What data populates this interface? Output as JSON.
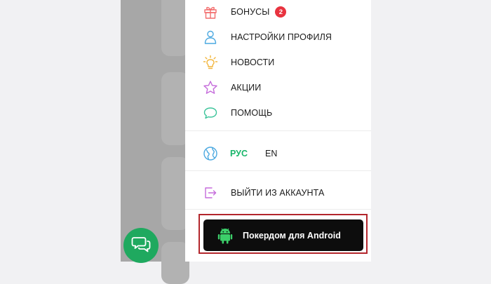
{
  "menu": {
    "bonuses": {
      "label": "БОНУСЫ",
      "badge": "2",
      "icon": "gift-icon"
    },
    "profile_settings": {
      "label": "НАСТРОЙКИ ПРОФИЛЯ",
      "icon": "user-icon"
    },
    "news": {
      "label": "НОВОСТИ",
      "icon": "lightbulb-icon"
    },
    "promotions": {
      "label": "АКЦИИ",
      "icon": "star-icon"
    },
    "help": {
      "label": "ПОМОЩЬ",
      "icon": "chat-bubble-icon"
    }
  },
  "language": {
    "icon": "globe-icon",
    "options": [
      "РУС",
      "EN"
    ],
    "selected": "РУС"
  },
  "logout": {
    "label": "ВЫЙТИ ИЗ АККАУНТА",
    "icon": "logout-icon"
  },
  "download": {
    "label": "Покердом для Android",
    "icon": "android-icon"
  },
  "chat_button": {
    "icon": "chat-icon"
  },
  "colors": {
    "accent_green": "#18b56a",
    "badge_red": "#e8333f",
    "button_dark": "#0d0d0d",
    "highlight_border": "#b3262c",
    "fab_green": "#1fa95f"
  }
}
